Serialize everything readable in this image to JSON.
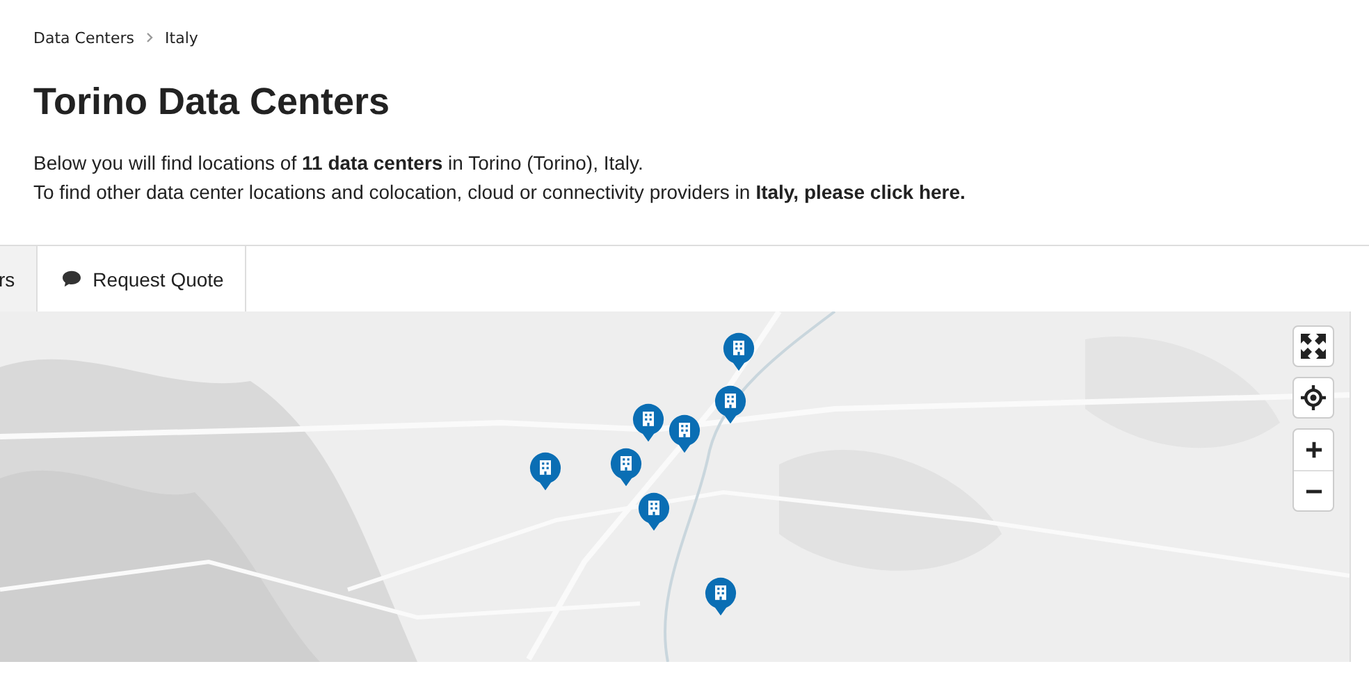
{
  "breadcrumb": [
    "Data Centers",
    "Italy"
  ],
  "title": "Torino Data Centers",
  "intro": "Below you will find locations of **11 data centers** in Torino (Torino), Italy.",
  "other": {
    "text": "To find other data center locations and colocation, cloud or connectivity providers in",
    "link": "Italy, please click here."
  },
  "tabs": [
    {
      "label": "rs",
      "selected": false,
      "kind": "plain"
    },
    {
      "label": "Request Quote",
      "selected": true,
      "kind": "quote"
    }
  ]
}
